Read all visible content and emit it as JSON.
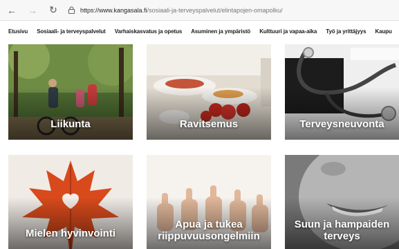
{
  "browser": {
    "back_icon": "←",
    "forward_icon": "→",
    "reload_icon": "↻",
    "url_host": "https://www.kangasala.fi",
    "url_path": "/sosiaali-ja-terveyspalvelut/elintapojen-omapolku/"
  },
  "nav": {
    "items": [
      "Etusivu",
      "Sosiaali- ja terveyspalvelut",
      "Varhaiskasvatus ja opetus",
      "Asuminen ja ympäristö",
      "Kulttuuri ja vapaa-aika",
      "Työ ja yrittäjyys",
      "Kaupu"
    ]
  },
  "tiles": [
    {
      "label": "Liikunta"
    },
    {
      "label": "Ravitsemus"
    },
    {
      "label": "Terveysneuvonta"
    },
    {
      "label": "Mielen hyvinvointi"
    },
    {
      "label_line1": "Apua ja tukea",
      "label_line2": "riippuvuusongelmiin"
    },
    {
      "label_line1": "Suun ja hampaiden",
      "label_line2": "terveys"
    }
  ],
  "colors": {
    "forest": "#3d5a2a",
    "food": "#d9d2c4",
    "tomato": "#c8281e",
    "leaf": "#d84a1c",
    "gray": "#8a8a8a"
  }
}
